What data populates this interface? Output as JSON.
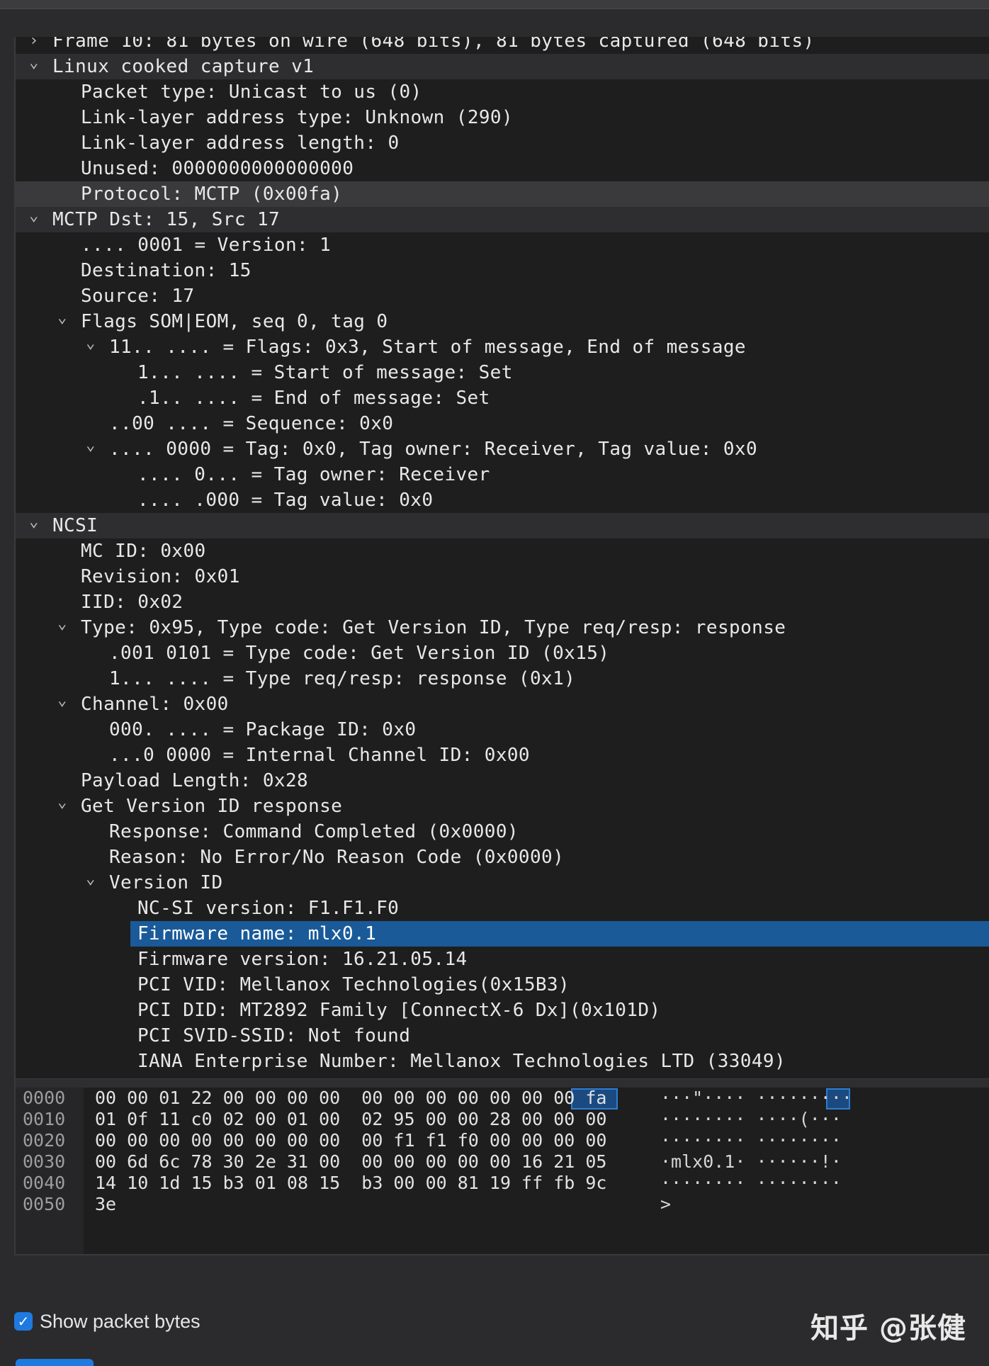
{
  "tree_rows": [
    {
      "text": "Frame 10: 81 bytes on wire (648 bits), 81 bytes captured (648 bits)",
      "level": 0,
      "chev": "collapsed"
    },
    {
      "text": "Linux cooked capture v1",
      "level": 0,
      "chev": "expanded"
    },
    {
      "text": "Packet type: Unicast to us (0)",
      "level": 2
    },
    {
      "text": "Link-layer address type: Unknown (290)",
      "level": 2
    },
    {
      "text": "Link-layer address length: 0",
      "level": 2
    },
    {
      "text": "Unused: 0000000000000000",
      "level": 2
    },
    {
      "text": "Protocol: MCTP (0x00fa)",
      "level": 2
    },
    {
      "text": "MCTP Dst: 15, Src 17",
      "level": 0,
      "chev": "expanded"
    },
    {
      "text": ".... 0001 = Version: 1",
      "level": 2
    },
    {
      "text": "Destination: 15",
      "level": 2
    },
    {
      "text": "Source: 17",
      "level": 2
    },
    {
      "text": "Flags SOM|EOM, seq 0, tag 0",
      "level": 2,
      "chev": "expanded"
    },
    {
      "text": "11.. .... = Flags: 0x3, Start of message, End of message",
      "level": 3,
      "chev": "expanded"
    },
    {
      "text": "1... .... = Start of message: Set",
      "level": 4
    },
    {
      "text": ".1.. .... = End of message: Set",
      "level": 4
    },
    {
      "text": "..00 .... = Sequence: 0x0",
      "level": 3
    },
    {
      "text": ".... 0000 = Tag: 0x0, Tag owner: Receiver, Tag value: 0x0",
      "level": 3,
      "chev": "expanded"
    },
    {
      "text": ".... 0... = Tag owner: Receiver",
      "level": 4
    },
    {
      "text": ".... .000 = Tag value: 0x0",
      "level": 4
    },
    {
      "text": "NCSI",
      "level": 0,
      "chev": "expanded"
    },
    {
      "text": "MC ID: 0x00",
      "level": 2
    },
    {
      "text": "Revision: 0x01",
      "level": 2
    },
    {
      "text": "IID: 0x02",
      "level": 2
    },
    {
      "text": "Type: 0x95, Type code: Get Version ID, Type req/resp: response",
      "level": 2,
      "chev": "expanded"
    },
    {
      "text": ".001 0101 = Type code: Get Version ID (0x15)",
      "level": 3
    },
    {
      "text": "1... .... = Type req/resp: response (0x1)",
      "level": 3
    },
    {
      "text": "Channel: 0x00",
      "level": 2,
      "chev": "expanded"
    },
    {
      "text": "000. .... = Package ID: 0x0",
      "level": 3
    },
    {
      "text": "...0 0000 = Internal Channel ID: 0x00",
      "level": 3
    },
    {
      "text": "Payload Length: 0x28",
      "level": 2
    },
    {
      "text": "Get Version ID response",
      "level": 2,
      "chev": "expanded"
    },
    {
      "text": "Response: Command Completed (0x0000)",
      "level": 3
    },
    {
      "text": "Reason: No Error/No Reason Code (0x0000)",
      "level": 3
    },
    {
      "text": "Version ID",
      "level": 3,
      "chev": "expanded"
    },
    {
      "text": "NC-SI version: F1.F1.F0",
      "level": 4
    },
    {
      "text": "Firmware name: mlx0.1",
      "level": 4,
      "selected": true
    },
    {
      "text": "Firmware version: 16.21.05.14",
      "level": 4
    },
    {
      "text": "PCI VID: Mellanox Technologies(0x15B3)",
      "level": 4
    },
    {
      "text": "PCI DID: MT2892 Family [ConnectX-6 Dx](0x101D)",
      "level": 4
    },
    {
      "text": "PCI SVID-SSID: Not found",
      "level": 4
    },
    {
      "text": "IANA Enterprise Number: Mellanox Technologies LTD (33049)",
      "level": 4
    }
  ],
  "hex_rows": [
    {
      "offset": "0000",
      "bytes": "00 00 01 22 00 00 00 00  00 00 00 00 00 00 00 fa",
      "ascii": "···\"···· ·········"
    },
    {
      "offset": "0010",
      "bytes": "01 0f 11 c0 02 00 01 00  02 95 00 00 28 00 00 00",
      "ascii": "········ ····(···"
    },
    {
      "offset": "0020",
      "bytes": "00 00 00 00 00 00 00 00  00 f1 f1 f0 00 00 00 00",
      "ascii": "········ ········"
    },
    {
      "offset": "0030",
      "bytes": "00 6d 6c 78 30 2e 31 00  00 00 00 00 00 16 21 05",
      "ascii": "·mlx0.1· ······!·"
    },
    {
      "offset": "0040",
      "bytes": "14 10 1d 15 b3 01 08 15  b3 00 00 81 19 ff fb 9c",
      "ascii": "········ ········"
    },
    {
      "offset": "0050",
      "bytes": "3e",
      "ascii": ">"
    }
  ],
  "footer": {
    "show_bytes_label": "Show packet bytes",
    "show_bytes_checked": true,
    "watermark": "知乎 @张健"
  },
  "colors": {
    "selection": "#1a5a99",
    "accent": "#1f7ae0"
  }
}
